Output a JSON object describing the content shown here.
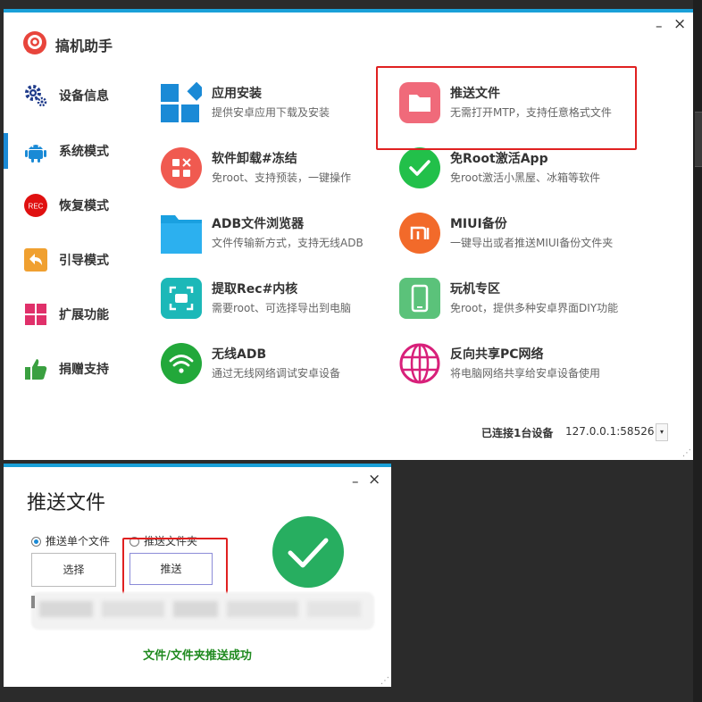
{
  "app": {
    "title": "搞机助手",
    "minimize": "–",
    "close": "×"
  },
  "sidebar": {
    "items": [
      {
        "label": "设备信息",
        "icon": "gear-icon"
      },
      {
        "label": "系统模式",
        "icon": "android-icon",
        "active": true
      },
      {
        "label": "恢复模式",
        "icon": "rec-icon",
        "badge": "REC"
      },
      {
        "label": "引导模式",
        "icon": "back-arrow-icon"
      },
      {
        "label": "扩展功能",
        "icon": "grid-icon"
      },
      {
        "label": "捐赠支持",
        "icon": "thumbs-up-icon"
      }
    ]
  },
  "features": [
    {
      "title": "应用安装",
      "desc": "提供安卓应用下载及安装",
      "icon": "app-install-icon",
      "color": "#1a8ad6"
    },
    {
      "title": "推送文件",
      "desc": "无需打开MTP，支持任意格式文件",
      "icon": "folder-icon",
      "color": "#f06a7a"
    },
    {
      "title": "软件卸载#冻结",
      "desc": "免root、支持预装，一键操作",
      "icon": "uninstall-icon",
      "color": "#f05a50"
    },
    {
      "title": "免Root激活App",
      "desc": "免root激活小黑屋、冰箱等软件",
      "icon": "check-icon",
      "color": "#22c04a"
    },
    {
      "title": "ADB文件浏览器",
      "desc": "文件传输新方式，支持无线ADB",
      "icon": "file-browser-icon",
      "color": "#1aa0e0"
    },
    {
      "title": "MIUI备份",
      "desc": "一键导出或者推送MIUI备份文件夹",
      "icon": "mi-icon",
      "color": "#f26a2a"
    },
    {
      "title": "提取Rec#内核",
      "desc": "需要root、可选择导出到电脑",
      "icon": "extract-icon",
      "color": "#1cb8b8"
    },
    {
      "title": "玩机专区",
      "desc": "免root，提供多种安卓界面DIY功能",
      "icon": "phone-icon",
      "color": "#5bc27a"
    },
    {
      "title": "无线ADB",
      "desc": "通过无线网络调试安卓设备",
      "icon": "wifi-icon",
      "color": "#22a83a"
    },
    {
      "title": "反向共享PC网络",
      "desc": "将电脑网络共享给安卓设备使用",
      "icon": "globe-icon",
      "color": "#d8207a"
    }
  ],
  "statusbar": {
    "status": "已连接1台设备",
    "ip": "127.0.0.1:58526",
    "dropdown": "▾"
  },
  "dialog": {
    "title": "推送文件",
    "close": "×",
    "radio_single": "推送单个文件",
    "radio_folder": "推送文件夹",
    "select_btn": "选择",
    "push_btn": "推送",
    "success": "文件/文件夹推送成功"
  },
  "colors": {
    "accent": "#1aa0d8",
    "highlight": "#e02020",
    "success": "#1f8a1f",
    "big_check": "#27ae60"
  }
}
